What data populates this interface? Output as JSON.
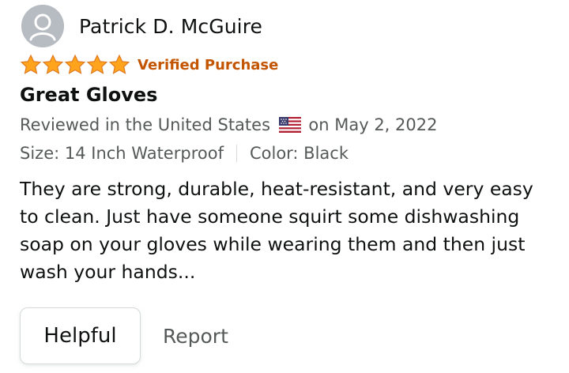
{
  "reviewer": {
    "name": "Patrick D. McGuire",
    "avatar_icon": "user-silhouette-icon"
  },
  "rating": {
    "stars": 5,
    "max": 5,
    "star_color": "#ffa41c",
    "star_outline": "#de7921"
  },
  "badge": {
    "verified_label": "Verified Purchase",
    "color": "#c45500"
  },
  "review": {
    "title": "Great Gloves",
    "location_prefix": "Reviewed in the United States",
    "flag_icon": "us-flag-icon",
    "date_text": "on May 2, 2022",
    "size": "Size: 14 Inch Waterproof",
    "color": "Color: Black",
    "body": "They are strong, durable, heat-resistant, and very easy to clean. Just have someone squirt some dishwashing soap on your gloves while wearing them and then just wash your hands..."
  },
  "actions": {
    "helpful_label": "Helpful",
    "report_label": "Report"
  }
}
